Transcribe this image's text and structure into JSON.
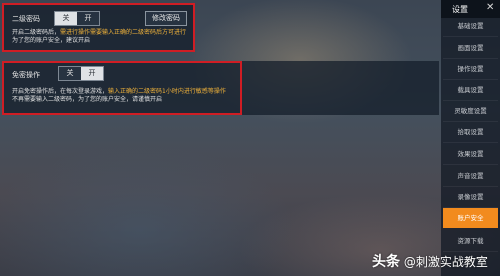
{
  "sidebar": {
    "title": "设置",
    "close_glyph": "✕",
    "items": [
      {
        "label": "基础设置",
        "active": false
      },
      {
        "label": "画面设置",
        "active": false
      },
      {
        "label": "操作设置",
        "active": false
      },
      {
        "label": "载具设置",
        "active": false
      },
      {
        "label": "灵敏度设置",
        "active": false
      },
      {
        "label": "拾取设置",
        "active": false
      },
      {
        "label": "效果设置",
        "active": false
      },
      {
        "label": "声音设置",
        "active": false
      },
      {
        "label": "录像设置",
        "active": false
      },
      {
        "label": "账户安全",
        "active": true
      },
      {
        "label": "资源下载",
        "active": false
      }
    ]
  },
  "secondary_password": {
    "label": "二级密码",
    "off": "关",
    "on": "开",
    "selected": "关",
    "change_button": "修改密码",
    "desc_part1": "开启二级密码后，",
    "desc_highlight": "需进行操作需要输入正确的二级密码后方可进行",
    "desc_part2": "为了您的账户安全，建议开启"
  },
  "password_free": {
    "label": "免密操作",
    "off": "关",
    "on": "开",
    "selected": "开",
    "desc_part1": "开启免密操作后，在每次登录游戏，",
    "desc_highlight": "输入正确的二级密码1小时内进行敏感等操作",
    "desc_part2": "不再需要输入二级密码，为了您的账户安全，请谨慎开启"
  },
  "watermark": {
    "brand": "头条",
    "handle": "@刺激实战教室"
  },
  "colors": {
    "highlight": "#f1b33a",
    "active_tab": "#f28b1e",
    "frame": "#d01d24"
  }
}
